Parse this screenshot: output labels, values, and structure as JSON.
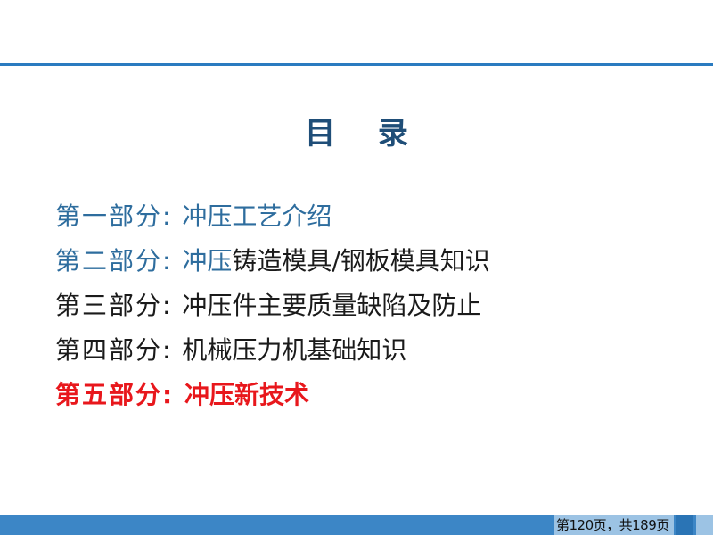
{
  "slide": {
    "title": "目  录",
    "toc": [
      {
        "segments": [
          {
            "text": "第一部分: ",
            "color": "blue"
          },
          {
            "text": "冲压工艺介绍",
            "color": "blue"
          }
        ]
      },
      {
        "segments": [
          {
            "text": "第二部分: ",
            "color": "blue"
          },
          {
            "text": "冲压",
            "color": "blue"
          },
          {
            "text": "铸造模具/钢板模具知识",
            "color": "black"
          }
        ]
      },
      {
        "segments": [
          {
            "text": "第三部分: ",
            "color": "black"
          },
          {
            "text": "冲压件主要质量缺陷及防止",
            "color": "black"
          }
        ]
      },
      {
        "segments": [
          {
            "text": "第四部分: ",
            "color": "black"
          },
          {
            "text": "机械压力机基础知识",
            "color": "black"
          }
        ]
      },
      {
        "segments": [
          {
            "text": "第五部分: ",
            "color": "red"
          },
          {
            "text": "冲压新技术",
            "color": "red"
          }
        ]
      }
    ],
    "footer": {
      "page_label": "第120页，共189页"
    }
  },
  "colors": {
    "title": "#1f4e78",
    "blue": "#2e6d9e",
    "black": "#1a1a1a",
    "red": "#e8171c",
    "rule": "#2a7bc0",
    "bar": "#3c86c6"
  }
}
